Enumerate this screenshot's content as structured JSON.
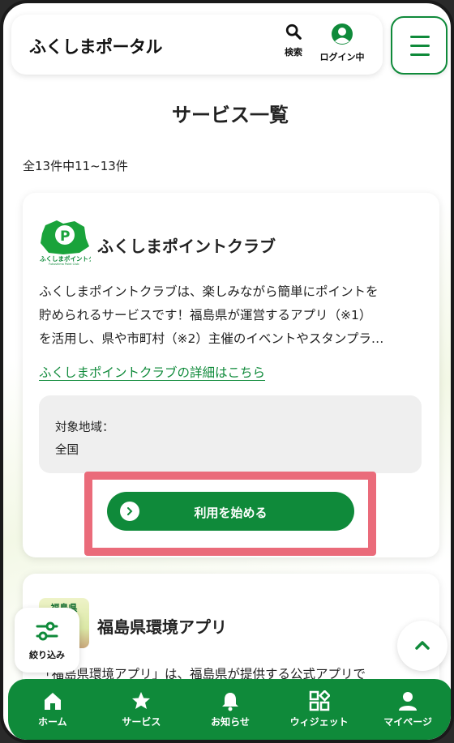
{
  "header": {
    "logo": "ふくしまポータル",
    "search_label": "検索",
    "login_label": "ログイン中"
  },
  "page": {
    "title": "サービス一覧",
    "count": "全13件中11~13件"
  },
  "card1": {
    "title": "ふくしまポイントクラブ",
    "logo_text": "ふくしまポイントクラブ",
    "logo_subtext": "Fukushima Point Club",
    "desc_line1": "ふくしまポイントクラブは、楽しみながら簡単にポイントを",
    "desc_line2": "貯められるサービスです！福島県が運営するアプリ（※1）",
    "desc_line3": "を活用し、県や市町村（※2）主催のイベントやスタンプラ…",
    "link": "ふくしまポイントクラブの詳細はこちら",
    "region_label": "対象地域：",
    "region_value": "全国",
    "button": "利用を始める"
  },
  "card2": {
    "title": "福島県環境アプリ",
    "logo_text": "福島県",
    "desc": "「福島県環境アプリ」は、福島県が提供する公式アプリで"
  },
  "filter": {
    "label": "絞り込み"
  },
  "bottom_nav": {
    "home": "ホーム",
    "service": "サービス",
    "notice": "お知らせ",
    "widget": "ウィジェット",
    "mypage": "マイページ"
  },
  "colors": {
    "accent": "#0f8a3a",
    "highlight": "#ea6b7a"
  }
}
